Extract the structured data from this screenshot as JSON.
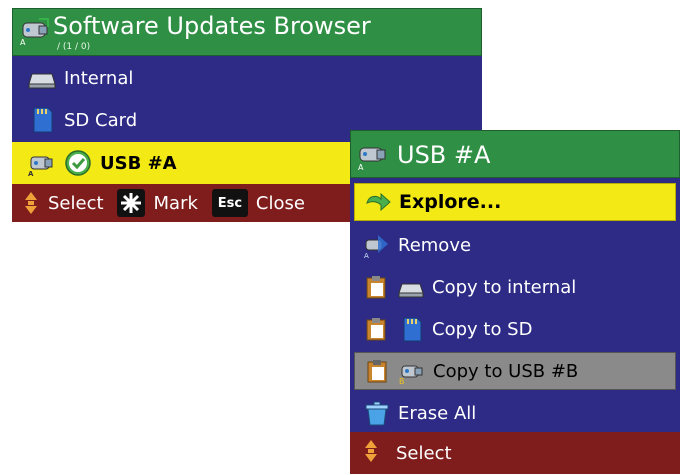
{
  "window": {
    "title": "Software Updates Browser",
    "subtitle": "/ (1 / 0)",
    "drives": [
      {
        "label": "Internal",
        "icon": "hard-drive-icon"
      },
      {
        "label": "SD Card",
        "icon": "sd-card-icon"
      },
      {
        "label": "USB #A",
        "icon": "usb-drive-icon",
        "selected": true,
        "check": "check-icon"
      }
    ],
    "footer": {
      "select_label": "Select",
      "mark_label": "Mark",
      "esc_key": "Esc",
      "close_label": "Close"
    }
  },
  "popup": {
    "title": "USB #A",
    "items": [
      {
        "label": "Explore...",
        "icon": "explore-arrow-icon",
        "state": "focused"
      },
      {
        "label": "Remove",
        "icon": "remove-usb-icon"
      },
      {
        "label": "Copy to internal",
        "icon": "copy-to-internal-icon"
      },
      {
        "label": "Copy to SD",
        "icon": "copy-to-sd-icon"
      },
      {
        "label": "Copy to USB #B",
        "icon": "copy-to-usb-icon",
        "state": "grey"
      },
      {
        "label": "Erase All",
        "icon": "erase-all-icon"
      }
    ],
    "footer": {
      "select_label": "Select"
    }
  },
  "colors": {
    "title_green": "#2f8f44",
    "list_blue": "#2d2b86",
    "highlight_yellow": "#f3e915",
    "footer_red": "#7f1d1d",
    "disabled_grey": "#8a8a8a"
  }
}
